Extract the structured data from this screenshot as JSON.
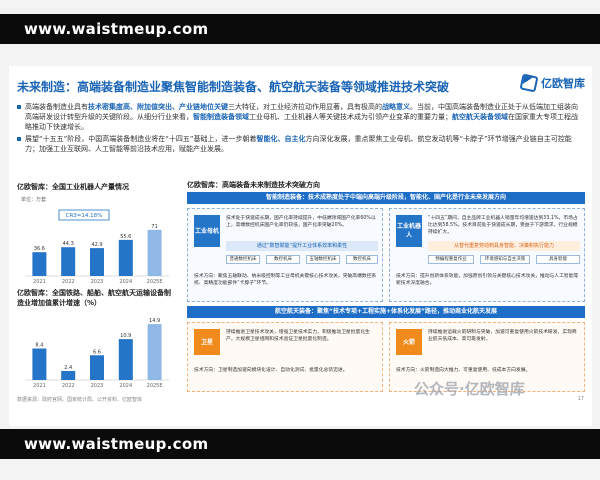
{
  "banner": {
    "text": "www.waistmeup.com"
  },
  "title": "未来制造：高端装备制造业聚焦智能制造装备、航空航天装备等领域推进技术突破",
  "logo": "亿欧智库",
  "bullets": [
    {
      "a": "高端装备制造业具有",
      "b": "技术密集度高、附加值突出、产业链地位关键",
      "c": "三大特征，对工业经济拉动作用显著，具有极高的",
      "d": "战略意义",
      "e": "。当前，中国高端装备制造业正处于从低端加工组装向高端研发设计转型升级的关键阶段。从细分行业来看，",
      "f": "智能制造装备领域",
      "g": "工业母机、工业机器人等关键技术成为引领产业变革的重要力量；",
      "h": "航空航天装备领域",
      "i": "在国家重大专项工程战略推动下快速增长。"
    },
    {
      "a": "展望“十五五”阶段，中国高端装备制造业将在“十四五”基础上，进一步朝着",
      "b": "智能化、自主化",
      "c": "方向深化发展，重点聚焦工业母机、航空发动机等“卡脖子”环节增强产业链自主可控能力；加强工业互联网、人工智能等前沿技术应用，赋能产业发展。",
      "d": "",
      "e": "",
      "f": "",
      "g": "",
      "h": "",
      "i": ""
    }
  ],
  "chart1": {
    "title": "亿欧智库：全国工业机器人产量情况",
    "unit": "单位：万套",
    "cagr": "CR3=14.18%",
    "labels": [
      "2021",
      "2022",
      "2023",
      "2024",
      "2025E"
    ],
    "values": [
      36.6,
      44.3,
      42.9,
      55.6,
      71
    ],
    "value_labels": [
      "36.6",
      "44.3",
      "42.9",
      "55.6",
      "71"
    ],
    "ylim": [
      0,
      80
    ]
  },
  "chart2": {
    "title": "亿欧智库：全国铁路、船舶、航空航天运输设备制造业增加值累计增速（%）",
    "labels": [
      "2021",
      "2022",
      "2023",
      "2024",
      "2025E"
    ],
    "values": [
      8.4,
      2.4,
      6.6,
      10.9,
      14.9
    ],
    "value_labels": [
      "8.4",
      "2.4",
      "6.6",
      "10.9",
      "14.9"
    ],
    "ylim": [
      0,
      16
    ]
  },
  "source": "数据来源：政府官网、国家统计局、公开资料、亿欧智库",
  "page_no": "17",
  "chart_data": [
    {
      "type": "bar",
      "title": "亿欧智库：全国工业机器人产量情况",
      "ylabel": "单位：万套",
      "categories": [
        "2021",
        "2022",
        "2023",
        "2024",
        "2025E"
      ],
      "values": [
        36.6,
        44.3,
        42.9,
        55.6,
        71
      ],
      "ylim": [
        0,
        80
      ],
      "annotation": "CR3=14.18%"
    },
    {
      "type": "bar",
      "title": "亿欧智库：全国铁路、船舶、航空航天运输设备制造业增加值累计增速（%）",
      "categories": [
        "2021",
        "2022",
        "2023",
        "2024",
        "2025E"
      ],
      "values": [
        8.4,
        2.4,
        6.6,
        10.9,
        14.9
      ],
      "ylim": [
        0,
        16
      ]
    }
  ],
  "diagram": {
    "title": "亿欧智库：高端装备未来制造技术突破方向",
    "sec1_head": "智能制造装备：技术成熟度处于中端向高端升级阶段，智能化、国产化是行业未来发展方向",
    "tag1": "工业母机",
    "tag1_text": "技术处于快速成长期，国产化率持续提升，中低端领域国产化率60%以上，高端数控机床国产化率仍较低，国产化率突破20%。",
    "flow_title": "通过“数智赋能”提升工业体系效率和柔性",
    "flow": [
      "普通数控机床",
      "数控机床",
      "五轴数控机床",
      "数控机床"
    ],
    "tag1_dir": "技术方向：聚焦五轴联动、纳米级控制等工业母机关键核心技术攻关，突破高端数控系统、高精度功能部件“卡脖子”环节。",
    "tag2": "工业机器人",
    "tag2_text": "“十四五”期间，自主品牌工业机器人销量年均增速达到33.1%，市场占比达到58.5%。技术目前处于快速成长期，受益于下游需求，行业规模持续扩大。",
    "tag2_bullets": [
      "从替代重复劳动到具身智能、决策和执行能力"
    ],
    "tag2_flow": [
      "预编程重复作业",
      "环境感知与自主决策",
      "具身智能"
    ],
    "tag2_dir": "技术方向：提升创新体系效能，加强原创引领与关键核心技术攻关，推动与人工智能等新技术深度融合。",
    "sec2_head": "航空航天装备：聚焦“技术专项+工程实施+体系化发展”路径，推动商业化航天发展",
    "tag3": "卫星",
    "tag3_text": "持续推进卫星技术攻关，增强卫星技术实力，积极推动卫星批量化生产，大规模卫星组网和技术验证卫星批量化制造。",
    "tag3_dir": "技术方向：卫星制造加速向模块化设计、自动化测试、批量化总装迈进。",
    "tag4": "火箭",
    "tag4_text": "持续推进运载火箭研制与突破，加速可重复使用火箭技术研发，实现商业航天低成本、高可靠发射。",
    "tag4_dir": "技术方向：火箭制造向大推力、可重复使用、低成本方向发展。",
    "watermark": "公众号·亿欧智库"
  }
}
